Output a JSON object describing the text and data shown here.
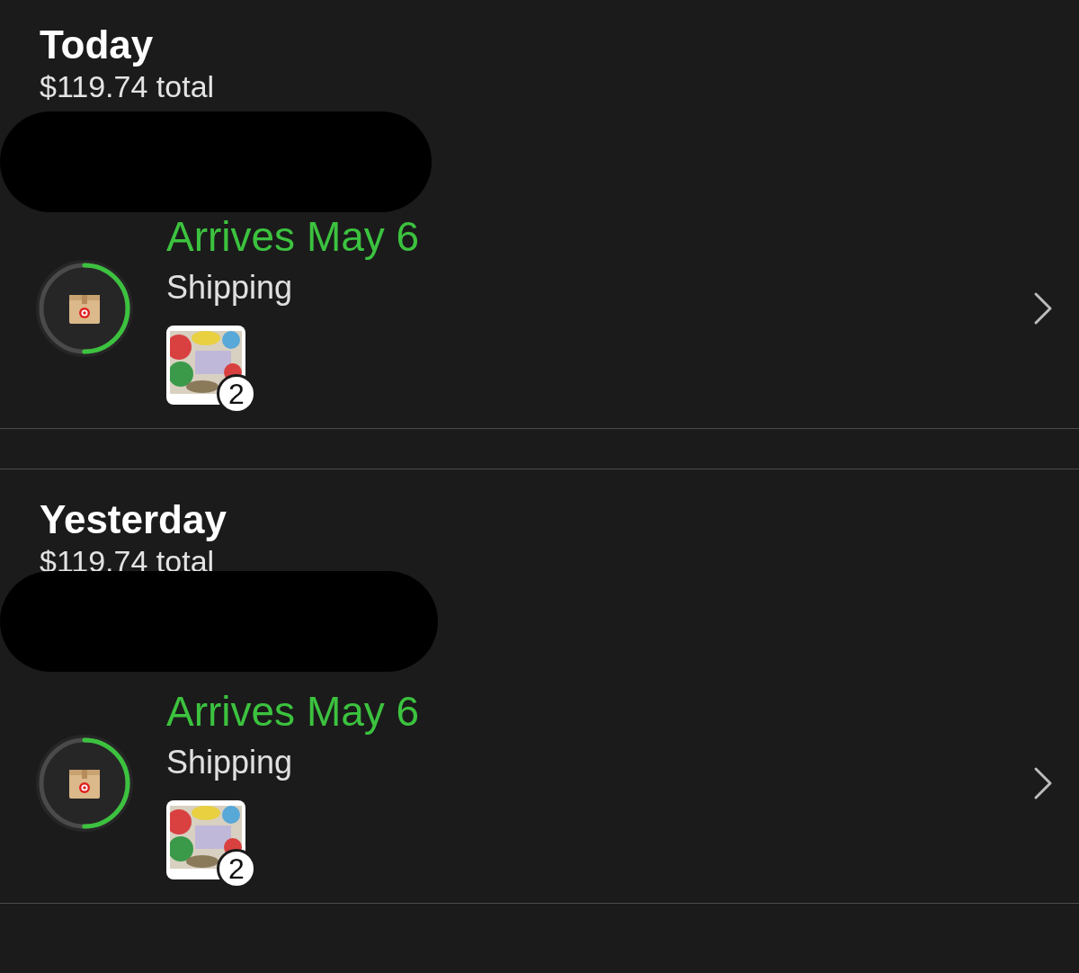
{
  "sections": [
    {
      "heading": "Today",
      "total": "$119.74 total",
      "orders": [
        {
          "arrival": "Arrives May 6",
          "status": "Shipping",
          "quantity": "2"
        }
      ]
    },
    {
      "heading": "Yesterday",
      "total": "$119.74 total",
      "orders": [
        {
          "arrival": "Arrives May 6",
          "status": "Shipping",
          "quantity": "2"
        }
      ]
    }
  ]
}
